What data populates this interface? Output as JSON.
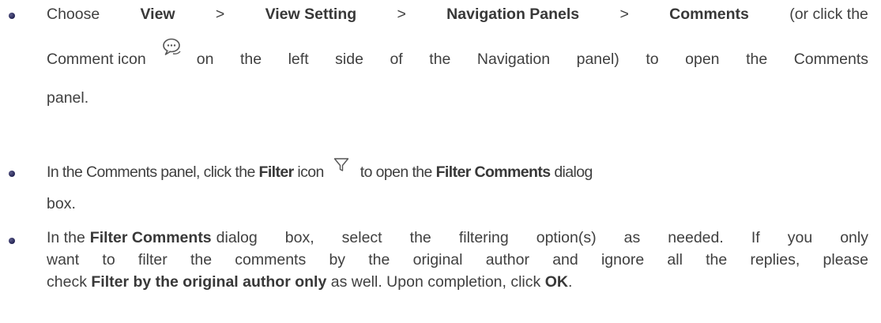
{
  "bullets": [
    {
      "line1": {
        "choose": "Choose",
        "view": "View",
        "sep1": ">",
        "view_setting": "View Setting",
        "sep2": ">",
        "nav_panels": "Navigation Panels",
        "sep3": ">",
        "comments": "Comments",
        "or_click": "(or click the"
      },
      "line2": {
        "comment_icon_text": "Comment icon",
        "rest": "on the left side of the Navigation panel) to open the Comments"
      },
      "line3": "panel."
    },
    {
      "line1": {
        "prefix": "In the Comments panel, click the",
        "filter": "Filter",
        "icon_word": "icon",
        "to_open": "to open the",
        "filter_comments": "Filter Comments",
        "dialog": "dialog"
      },
      "line2": "box."
    },
    {
      "line1": {
        "prefix": "In the",
        "filter_comments": "Filter Comments",
        "rest": "dialog box, select the filtering option(s) as needed. If you only"
      },
      "line2": "want to filter the comments by the original author and ignore all the replies, please",
      "line3": {
        "check": "check",
        "bold": "Filter by the original author only",
        "rest": "as well. Upon completion, click",
        "ok": "OK",
        "period": "."
      }
    }
  ]
}
